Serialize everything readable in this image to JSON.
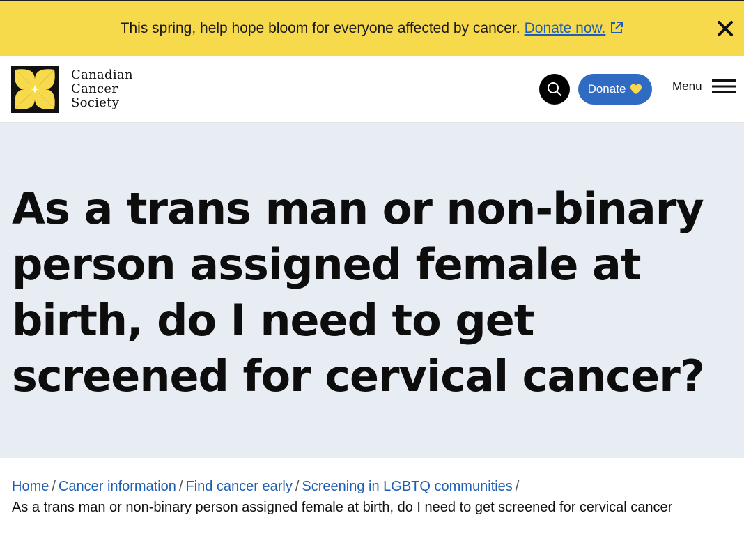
{
  "banner": {
    "message": "This spring, help hope bloom for everyone affected by cancer.",
    "link_label": "Donate now.",
    "close_icon": "close-icon",
    "link_icon": "external-link-icon"
  },
  "header": {
    "logo": {
      "line1": "Canadian",
      "line2": "Cancer",
      "line3": "Society"
    },
    "search_icon": "search-icon",
    "donate_label": "Donate",
    "donate_icon": "heart-icon",
    "menu_label": "Menu",
    "menu_icon": "hamburger-icon"
  },
  "hero": {
    "title": "As a trans man or non-binary person assigned female at birth, do I need to get screened for cervical cancer?"
  },
  "breadcrumb": {
    "items": [
      "Home",
      "Cancer information",
      "Find cancer early",
      "Screening in LGBTQ communities"
    ],
    "separator": "/",
    "current": "As a trans man or non-binary person assigned female at birth, do I need to get screened for cervical cancer"
  },
  "colors": {
    "banner_bg": "#f7d94c",
    "hero_bg": "#e8edf3",
    "brand_blue": "#2f6bc2",
    "link_blue": "#1f5fb3",
    "logo_yellow": "#f7d94c"
  }
}
